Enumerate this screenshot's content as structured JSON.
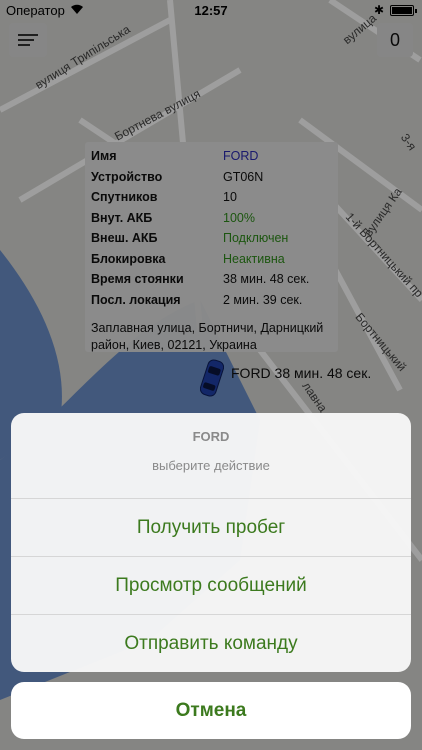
{
  "status_bar": {
    "carrier": "Оператор",
    "time": "12:57",
    "battery_level_percent": 100
  },
  "map": {
    "streets": [
      "вулиця Трипільська",
      "Бортнева вулиця",
      "вулиця Ка",
      "1-й Бортницький пр",
      "3-я ",
      "Бортницький ",
      "лавна",
      "вулица"
    ]
  },
  "header": {
    "counter": "0"
  },
  "info": {
    "rows": [
      {
        "key": "Имя",
        "value": "FORD",
        "color": "#2b2bb0"
      },
      {
        "key": "Устройство",
        "value": "GT06N",
        "color": "#111111"
      },
      {
        "key": "Спутников",
        "value": "10",
        "color": "#111111"
      },
      {
        "key": "Внут. АКБ",
        "value": "100%",
        "color": "#2e8b1a"
      },
      {
        "key": "Внеш. АКБ",
        "value": "Подключен",
        "color": "#2e8b1a"
      },
      {
        "key": "Блокировка",
        "value": "Неактивна",
        "color": "#2e8b1a"
      },
      {
        "key": "Время стоянки",
        "value": "38 мин. 48 сек.",
        "color": "#111111"
      },
      {
        "key": "Посл. локация",
        "value": "2 мин. 39 сек.",
        "color": "#111111"
      }
    ],
    "address": "Заплавная улица, Бортничи, Дарницкий район, Киев, 02121, Украина"
  },
  "car_label": "FORD 38 мин. 48 сек.",
  "action_sheet": {
    "title": "FORD",
    "subtitle": "выберите действие",
    "actions": [
      "Получить пробег",
      "Просмотр сообщений",
      "Отправить команду"
    ],
    "cancel": "Отмена"
  },
  "colors": {
    "accent": "#3c7a1e",
    "water": "#6b8fc9"
  }
}
